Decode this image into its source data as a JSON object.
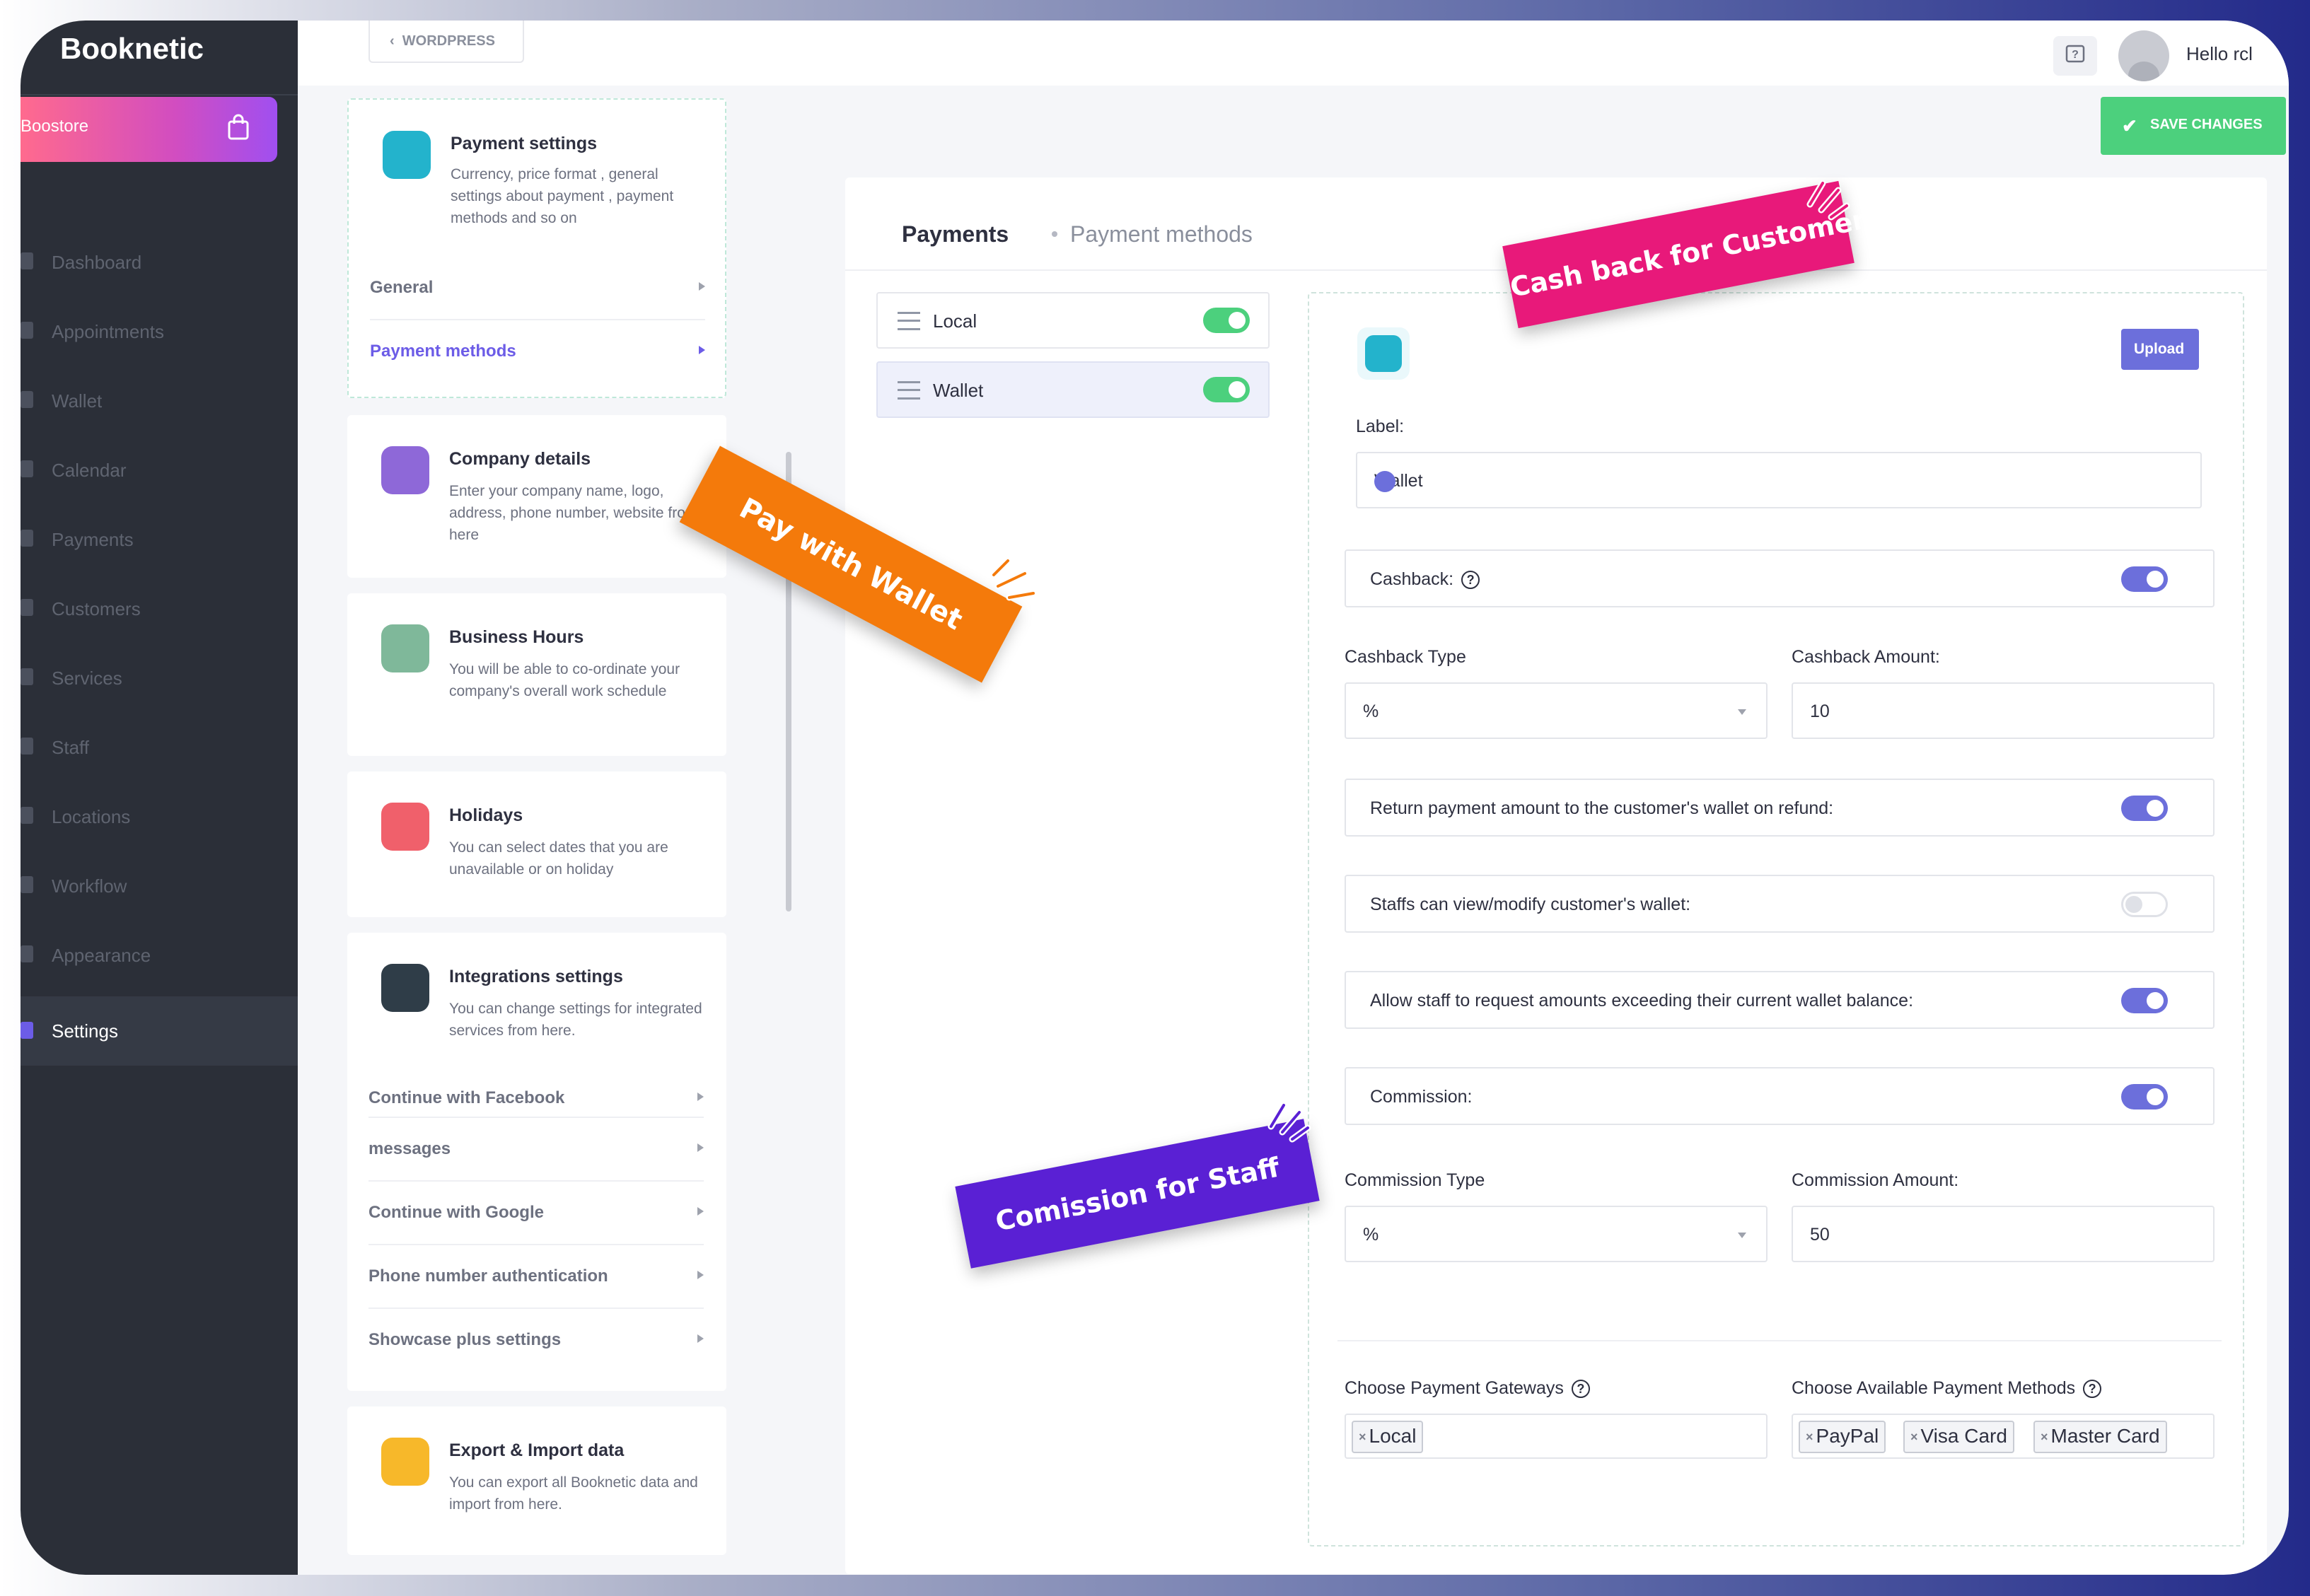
{
  "app": {
    "brand": "Booknetic",
    "store_label": "Boostore"
  },
  "sidebar": {
    "items": [
      {
        "label": "Dashboard"
      },
      {
        "label": "Appointments"
      },
      {
        "label": "Wallet"
      },
      {
        "label": "Calendar"
      },
      {
        "label": "Payments"
      },
      {
        "label": "Customers"
      },
      {
        "label": "Services"
      },
      {
        "label": "Staff"
      },
      {
        "label": "Locations"
      },
      {
        "label": "Workflow"
      },
      {
        "label": "Appearance"
      },
      {
        "label": "Settings"
      }
    ],
    "active": "Settings"
  },
  "topbar": {
    "wordpress_label": "WORDPRESS",
    "greeting": "Hello rcl"
  },
  "settings_cards": {
    "payment": {
      "title": "Payment settings",
      "description": "Currency, price format , general settings about payment , payment methods and so on",
      "subs": [
        "General",
        "Payment methods"
      ]
    },
    "company": {
      "title": "Company details",
      "description": "Enter your company name, logo, address, phone number, website from here"
    },
    "hours": {
      "title": "Business Hours",
      "description": "You will be able to co-ordinate your company's overall work schedule"
    },
    "holidays": {
      "title": "Holidays",
      "description": "You can select dates that you are unavailable or on holiday"
    },
    "integrations": {
      "title": "Integrations settings",
      "description": "You can change settings for integrated services from here.",
      "subs": [
        "Continue with Facebook",
        "messages",
        "Continue with Google",
        "Phone number authentication",
        "Showcase plus settings"
      ]
    },
    "export": {
      "title": "Export & Import data",
      "description": "You can export all Booknetic data and import from here."
    }
  },
  "toolbar": {
    "save_label": "SAVE CHANGES"
  },
  "panel": {
    "title": "Payments",
    "subtitle": "Payment methods",
    "methods": [
      {
        "name": "Local",
        "enabled": true
      },
      {
        "name": "Wallet",
        "enabled": true
      }
    ],
    "upload_label": "Upload",
    "label_field": {
      "label": "Label:",
      "value": "Wallet"
    },
    "cashback": {
      "label": "Cashback:",
      "enabled": true
    },
    "cashback_type": {
      "label": "Cashback Type",
      "value": "%"
    },
    "cashback_amount": {
      "label": "Cashback Amount:",
      "value": "10"
    },
    "return_refund": {
      "label": "Return payment amount to the customer's wallet on refund:",
      "enabled": true
    },
    "staff_modify": {
      "label": "Staffs can view/modify customer's wallet:",
      "enabled": false
    },
    "staff_exceed": {
      "label": "Allow staff to request amounts exceeding their current wallet balance:",
      "enabled": true
    },
    "commission": {
      "label": "Commission:",
      "enabled": true
    },
    "commission_type": {
      "label": "Commission Type",
      "value": "%"
    },
    "commission_amount": {
      "label": "Commission Amount:",
      "value": "50"
    },
    "gateways": {
      "label": "Choose Payment Gateways",
      "tags": [
        "Local"
      ]
    },
    "available_methods": {
      "label": "Choose Available Payment Methods",
      "tags": [
        "PayPal",
        "Visa Card",
        "Master Card"
      ]
    }
  },
  "stickers": {
    "cashback": "Cash back for Customer",
    "wallet": "Pay with Wallet",
    "commission": "Comission for Staff"
  },
  "colors": {
    "accent": "#6c6fdb",
    "success": "#4cd07d",
    "sidebar_bg": "#2b2f38",
    "sticker_pink": "#e8197a",
    "sticker_orange": "#f47a0b",
    "sticker_purple": "#5a20d4"
  }
}
